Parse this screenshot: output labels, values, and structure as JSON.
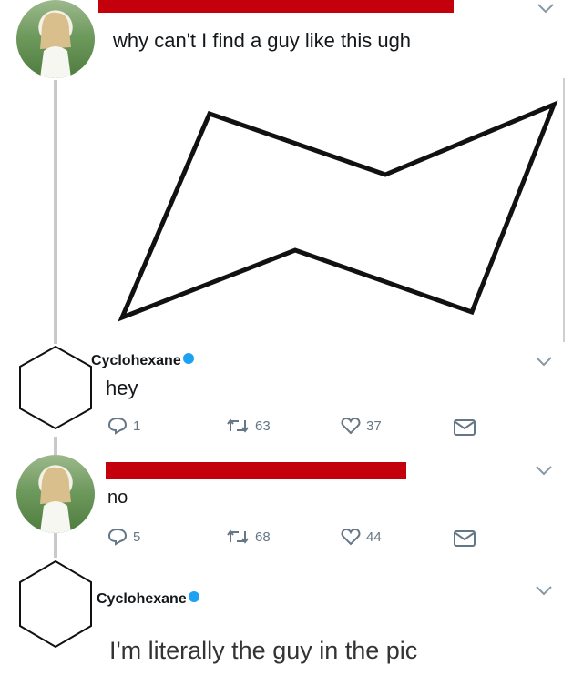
{
  "tweet1": {
    "text": "why can't I find a guy like this ugh"
  },
  "reply1": {
    "username": "Cyclohexane",
    "text": "hey",
    "replies": "1",
    "retweets": "63",
    "likes": "37"
  },
  "reply2": {
    "text": "no",
    "replies": "5",
    "retweets": "68",
    "likes": "44"
  },
  "reply3": {
    "username": "Cyclohexane",
    "text": "I'm literally the guy in the pic"
  },
  "colors": {
    "redaction": "#c4000c",
    "verified": "#1da1f2",
    "action_icon": "#657786"
  },
  "icons": [
    "chevron-down-icon",
    "reply-icon",
    "retweet-icon",
    "like-icon",
    "message-icon",
    "verified-badge-icon"
  ]
}
